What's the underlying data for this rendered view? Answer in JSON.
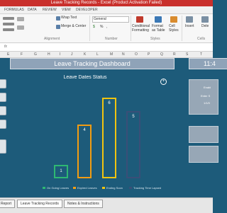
{
  "app": {
    "title": "Leave Tracking Records  -  Excel (Product Activation Failed)"
  },
  "ribbon_tabs": [
    "FORMULAS",
    "DATA",
    "REVIEW",
    "VIEW",
    "DEVELOPER"
  ],
  "ribbon": {
    "wrap_text": "Wrap Text",
    "merge_center": "Merge & Center",
    "number_format": "General",
    "currency_symbol": "$",
    "percent_symbol": "%",
    "comma_symbol": ",",
    "conditional_formatting": "Conditional Formatting",
    "format_as_table": "Format as Table",
    "cell_styles": "Cell Styles",
    "insert": "Insert",
    "delete": "Dele",
    "group_alignment": "Alignment",
    "group_number": "Number",
    "group_styles": "Styles",
    "group_cells": "Cells"
  },
  "formula_bar": {
    "fx": "fx"
  },
  "columns": [
    "E",
    "F",
    "G",
    "H",
    "I",
    "J",
    "K",
    "L",
    "M",
    "N",
    "O",
    "P",
    "Q",
    "R",
    "S",
    "T"
  ],
  "dashboard": {
    "title": "Leave Tracking Dashboard",
    "clock": "11:4",
    "side_panel": {
      "line1": "Enabl",
      "line2": "Enter S",
      "line3": "1/1/0"
    }
  },
  "chart_data": {
    "type": "bar",
    "title": "Leave Dates Status",
    "categories": [
      "On Going Leaves",
      "Expired Leaves",
      "Ending Soon",
      "Tracking Time Lapsed"
    ],
    "values": [
      1,
      4,
      6,
      5
    ],
    "colors": [
      "#2eb872",
      "#f39c12",
      "#f1c40f",
      "#3a4f78"
    ],
    "legend_position": "bottom"
  },
  "sheets": [
    "Report",
    "Leave Tracking Records",
    "Notes & Instructions"
  ]
}
